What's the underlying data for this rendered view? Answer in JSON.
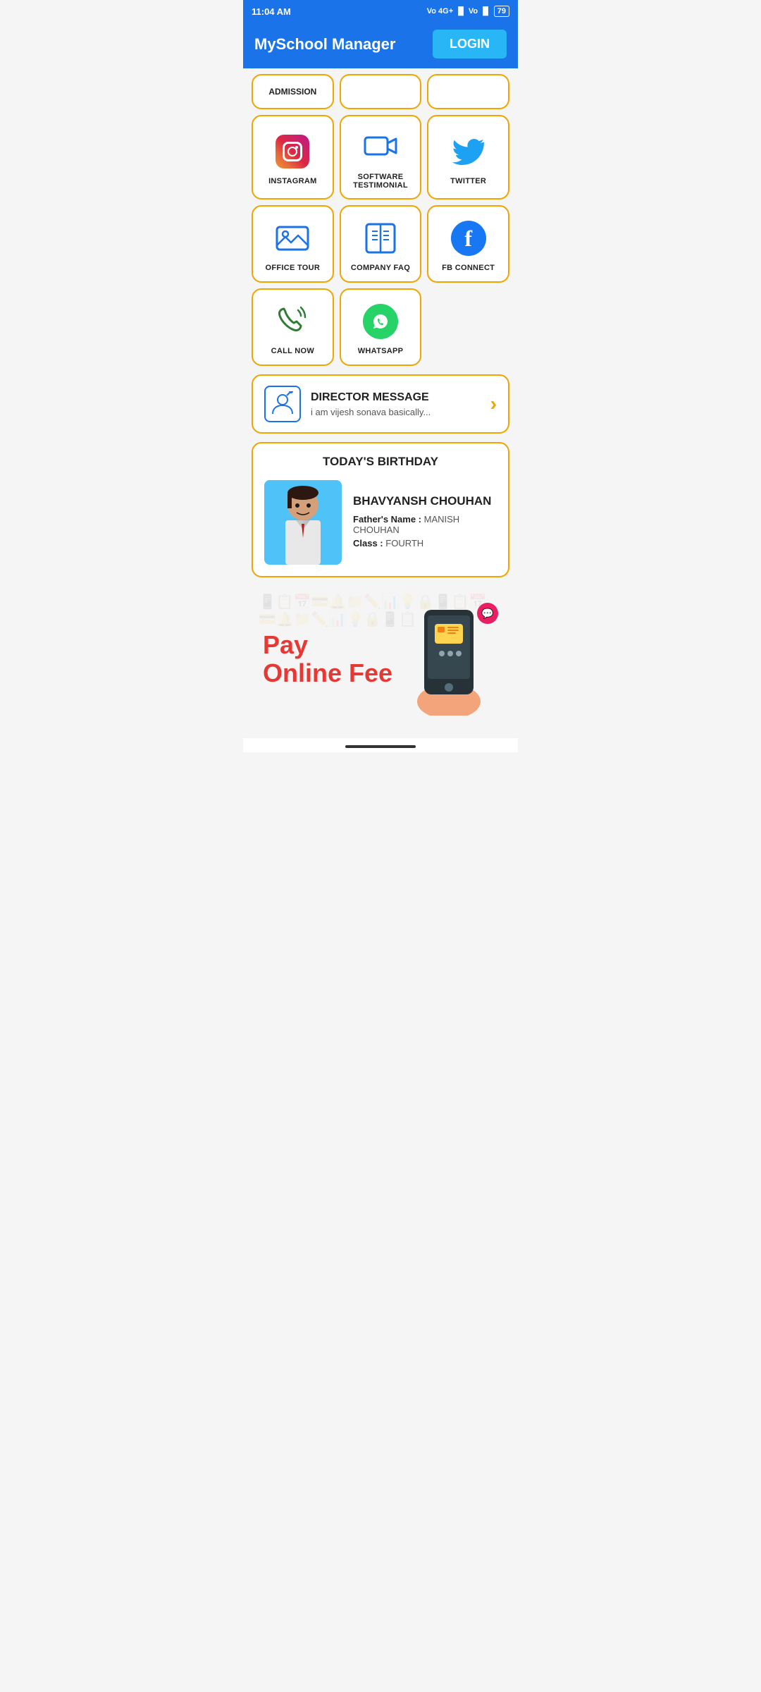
{
  "statusBar": {
    "time": "11:04 AM",
    "battery": "79",
    "signal": "4G+"
  },
  "header": {
    "title": "MySchool Manager",
    "loginLabel": "LOGIN"
  },
  "admissionRow": {
    "items": [
      {
        "label": "ADMISSION"
      },
      {
        "label": ""
      },
      {
        "label": ""
      }
    ]
  },
  "iconGrid": {
    "row1": [
      {
        "id": "instagram",
        "label": "INSTAGRAM"
      },
      {
        "id": "software-testimonial",
        "label": "SOFTWARE TESTIMONIAL"
      },
      {
        "id": "twitter",
        "label": "TWITTER"
      }
    ],
    "row2": [
      {
        "id": "office-tour",
        "label": "OFFICE TOUR"
      },
      {
        "id": "company-faq",
        "label": "COMPANY FAQ"
      },
      {
        "id": "fb-connect",
        "label": "FB CONNECT"
      }
    ],
    "row3": [
      {
        "id": "call-now",
        "label": "CALL NOW"
      },
      {
        "id": "whatsapp",
        "label": "WHATSAPP"
      }
    ]
  },
  "directorMessage": {
    "title": "DIRECTOR MESSAGE",
    "subtitle": "i am vijesh sonava basically...",
    "arrowLabel": "›"
  },
  "birthday": {
    "sectionTitle": "TODAY'S BIRTHDAY",
    "name": "BHAVYANSH CHOUHAN",
    "fatherLabel": "Father's Name :",
    "fatherName": "MANISH CHOUHAN",
    "classLabel": "Class :",
    "className": "FOURTH"
  },
  "payBanner": {
    "line1": "Pay",
    "line2": "Online Fee"
  }
}
